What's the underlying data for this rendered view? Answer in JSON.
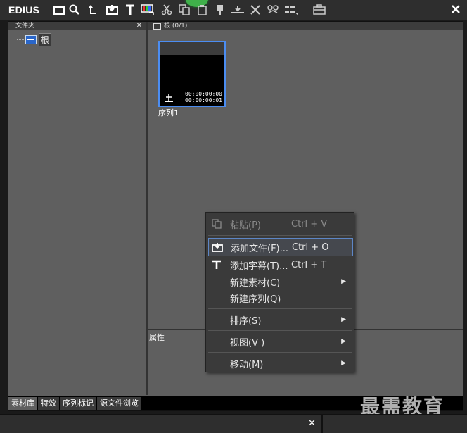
{
  "app": {
    "logo": "EDIUS"
  },
  "left_panel": {
    "title": "文件夹",
    "close": "✕",
    "root_label": "根"
  },
  "right_panel": {
    "title": "根 (0/1)"
  },
  "clip": {
    "name": "序列1",
    "tc_in": "00:00:00:00",
    "tc_out": "00:00:00:01"
  },
  "props": {
    "title": "属性"
  },
  "tabs": [
    "素材库",
    "特效",
    "序列标记",
    "源文件浏览"
  ],
  "context_menu": {
    "paste": {
      "label": "粘贴(P)",
      "shortcut": "Ctrl + V"
    },
    "add_file": {
      "label": "添加文件(F)...",
      "shortcut": "Ctrl + O"
    },
    "add_title": {
      "label": "添加字幕(T)...",
      "shortcut": "Ctrl + T"
    },
    "new_clip": {
      "label": "新建素材(C)"
    },
    "new_sequence": {
      "label": "新建序列(Q)"
    },
    "sort": {
      "label": "排序(S)"
    },
    "view": {
      "label": "视图(V )"
    },
    "move": {
      "label": "移动(M)"
    }
  },
  "watermark": "最需教育",
  "window_close": "✕"
}
